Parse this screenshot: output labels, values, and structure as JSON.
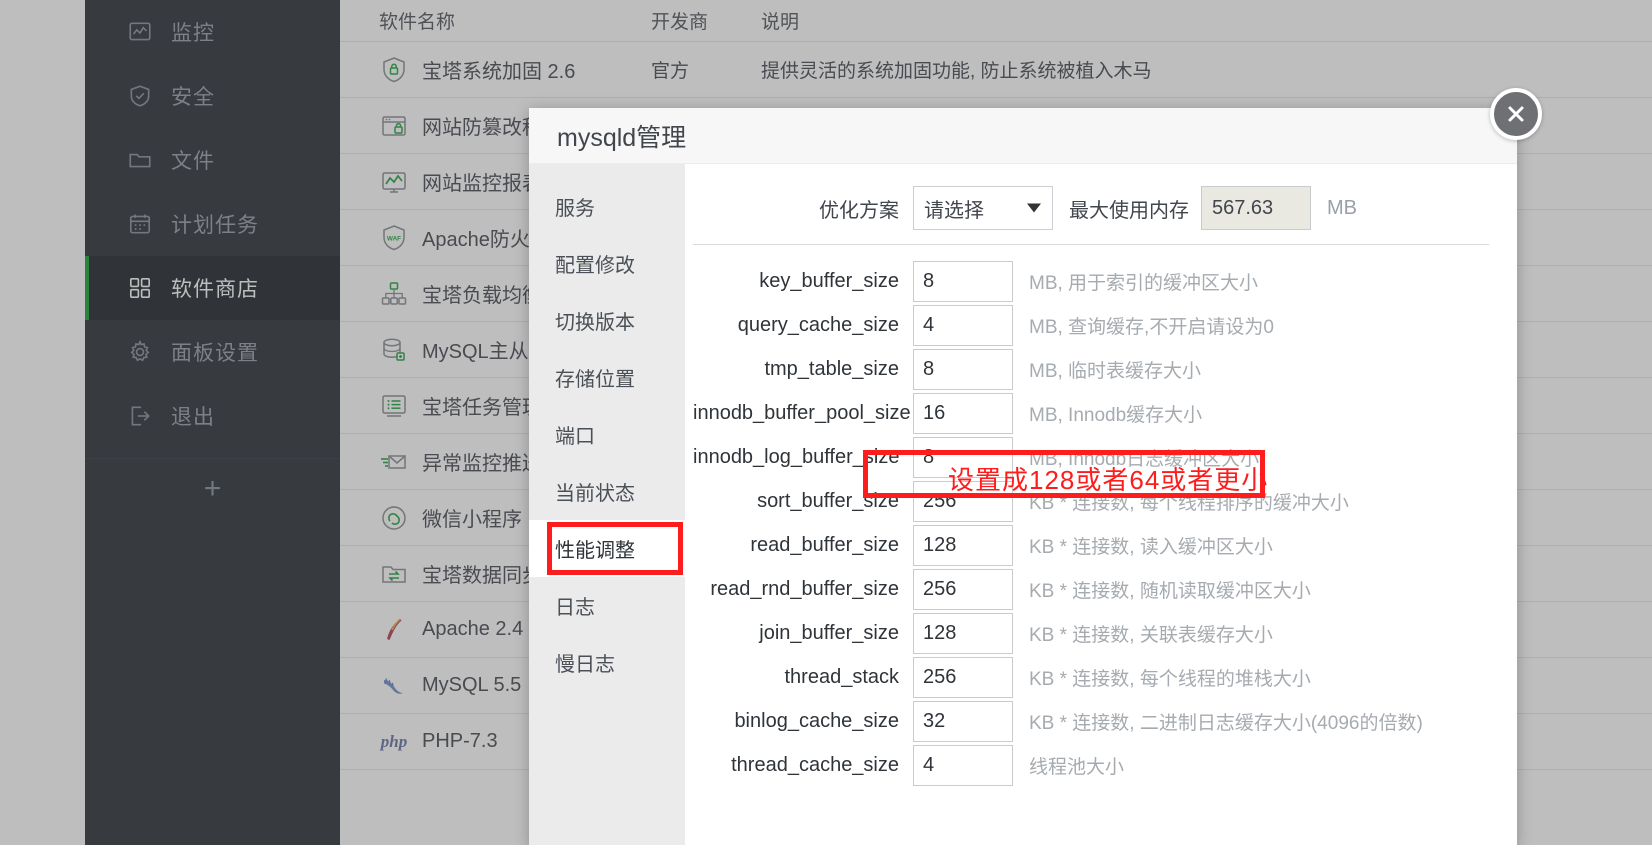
{
  "sidebar": {
    "items": [
      {
        "label": "监控",
        "icon": "monitor-chart-icon",
        "active": false
      },
      {
        "label": "安全",
        "icon": "shield-check-icon",
        "active": false
      },
      {
        "label": "文件",
        "icon": "folder-icon",
        "active": false
      },
      {
        "label": "计划任务",
        "icon": "calendar-icon",
        "active": false
      },
      {
        "label": "软件商店",
        "icon": "grid-apps-icon",
        "active": true
      },
      {
        "label": "面板设置",
        "icon": "gear-icon",
        "active": false
      },
      {
        "label": "退出",
        "icon": "logout-icon",
        "active": false
      }
    ],
    "add_label": "+"
  },
  "table": {
    "headers": {
      "name": "软件名称",
      "dev": "开发商",
      "desc": "说明"
    },
    "rows": [
      {
        "name": "宝塔系统加固 2.6",
        "icon": "shield-lock-icon",
        "dev": "官方",
        "desc": "提供灵活的系统加固功能, 防止系统被植入木马"
      },
      {
        "name": "网站防篡改程序",
        "icon": "browser-lock-icon",
        "dev": "",
        "desc": ""
      },
      {
        "name": "网站监控报表",
        "icon": "monitor-graph-icon",
        "dev": "",
        "desc": ""
      },
      {
        "name": "Apache防火墙",
        "icon": "waf-shield-icon",
        "dev": "",
        "desc": ""
      },
      {
        "name": "宝塔负载均衡",
        "icon": "sitemap-icon",
        "dev": "",
        "desc": ""
      },
      {
        "name": "MySQL主从复制",
        "icon": "database-icon",
        "dev": "",
        "desc": ""
      },
      {
        "name": "宝塔任务管理",
        "icon": "tasklist-icon",
        "dev": "",
        "desc": ""
      },
      {
        "name": "异常监控推送",
        "icon": "mail-send-icon",
        "dev": "",
        "desc": ""
      },
      {
        "name": "微信小程序",
        "icon": "wechat-mini-icon",
        "dev": "",
        "desc": ""
      },
      {
        "name": "宝塔数据同步",
        "icon": "folder-sync-icon",
        "dev": "",
        "desc": ""
      },
      {
        "name": "Apache 2.4",
        "icon": "apache-feather-icon",
        "dev": "",
        "desc": ""
      },
      {
        "name": "MySQL 5.5",
        "icon": "mysql-dolphin-icon",
        "dev": "",
        "desc": ""
      },
      {
        "name": "PHP-7.3",
        "icon": "php-icon",
        "dev": "",
        "desc": ""
      }
    ]
  },
  "modal": {
    "title": "mysqld管理",
    "close_icon": "close-icon",
    "menu": [
      {
        "label": "服务",
        "selected": false
      },
      {
        "label": "配置修改",
        "selected": false
      },
      {
        "label": "切换版本",
        "selected": false
      },
      {
        "label": "存储位置",
        "selected": false
      },
      {
        "label": "端口",
        "selected": false
      },
      {
        "label": "当前状态",
        "selected": false
      },
      {
        "label": "性能调整",
        "selected": true
      },
      {
        "label": "日志",
        "selected": false
      },
      {
        "label": "慢日志",
        "selected": false
      }
    ],
    "top": {
      "scheme_label": "优化方案",
      "scheme_value": "请选择",
      "caret_icon": "chevron-down-icon",
      "mem_label": "最大使用内存",
      "mem_value": "567.63",
      "mem_unit": "MB"
    },
    "fields": [
      {
        "label": "key_buffer_size",
        "value": "8",
        "hint": "MB, 用于索引的缓冲区大小"
      },
      {
        "label": "query_cache_size",
        "value": "4",
        "hint": "MB, 查询缓存,不开启请设为0"
      },
      {
        "label": "tmp_table_size",
        "value": "8",
        "hint": "MB, 临时表缓存大小"
      },
      {
        "label": "innodb_buffer_pool_size",
        "value": "16",
        "hint": "MB, Innodb缓存大小"
      },
      {
        "label": "innodb_log_buffer_size",
        "value": "8",
        "hint": "MB, Innodb日志缓冲区大小"
      },
      {
        "label": "sort_buffer_size",
        "value": "256",
        "hint": "KB * 连接数, 每个线程排序的缓冲大小"
      },
      {
        "label": "read_buffer_size",
        "value": "128",
        "hint": "KB * 连接数, 读入缓冲区大小"
      },
      {
        "label": "read_rnd_buffer_size",
        "value": "256",
        "hint": "KB * 连接数, 随机读取缓冲区大小"
      },
      {
        "label": "join_buffer_size",
        "value": "128",
        "hint": "KB * 连接数, 关联表缓存大小"
      },
      {
        "label": "thread_stack",
        "value": "256",
        "hint": "KB * 连接数, 每个线程的堆栈大小"
      },
      {
        "label": "binlog_cache_size",
        "value": "32",
        "hint": "KB * 连接数, 二进制日志缓存大小(4096的倍数)"
      },
      {
        "label": "thread_cache_size",
        "value": "4",
        "hint": "线程池大小"
      }
    ],
    "annotation": {
      "text": "设置成128或者64或者更小",
      "color": "#fd1d1d"
    }
  },
  "colors": {
    "sidebar_bg": "#31363e",
    "sidebar_active_bg": "#262a31",
    "accent_green": "#20a53a",
    "annotation_red": "#fd1d1d"
  }
}
